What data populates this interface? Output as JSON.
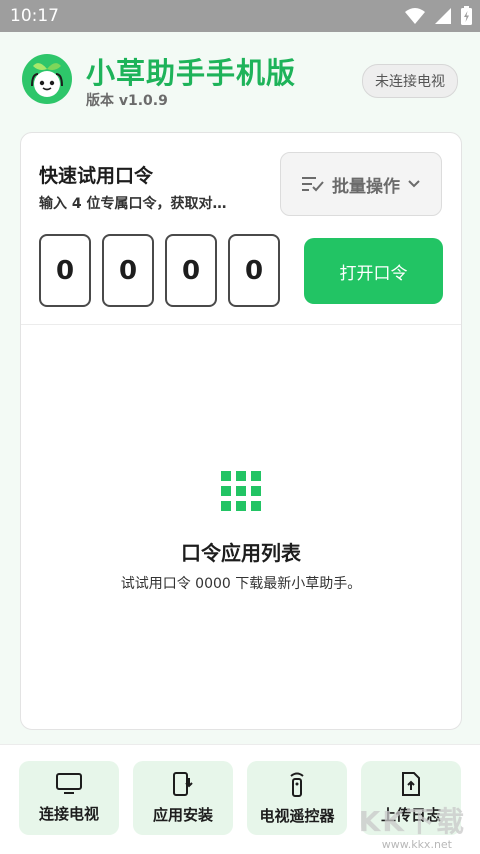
{
  "status_bar": {
    "time": "10:17"
  },
  "header": {
    "title": "小草助手手机版",
    "version_label": "版本",
    "version": "v1.0.9",
    "tv_status": "未连接电视"
  },
  "quick_code": {
    "title": "快速试用口令",
    "subtitle": "输入 4 位专属口令，获取对…",
    "batch_label": "批量操作",
    "digits": [
      "0",
      "0",
      "0",
      "0"
    ],
    "open_label": "打开口令"
  },
  "code_list": {
    "title": "口令应用列表",
    "description": "试试用口令 0000 下载最新小草助手。"
  },
  "bottom_nav": [
    {
      "label": "连接电视",
      "icon": "tv-icon"
    },
    {
      "label": "应用安装",
      "icon": "phone-download-icon"
    },
    {
      "label": "电视遥控器",
      "icon": "remote-control-icon"
    },
    {
      "label": "上传日志",
      "icon": "upload-file-icon"
    }
  ],
  "watermark": {
    "text": "KK下载",
    "url": "www.kkx.net"
  },
  "colors": {
    "accent": "#22c464",
    "title_green": "#1eb35a",
    "soft_green": "#e7f6ea"
  }
}
